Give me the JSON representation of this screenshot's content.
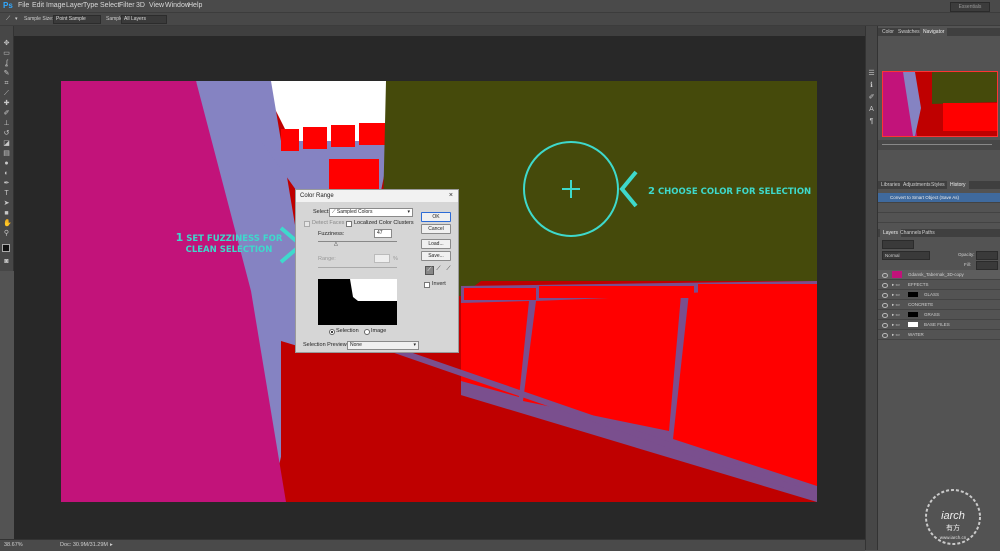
{
  "app": {
    "logo": "Ps"
  },
  "menu": [
    "File",
    "Edit",
    "Image",
    "Layer",
    "Type",
    "Select",
    "Filter",
    "3D",
    "View",
    "Window",
    "Help"
  ],
  "workspace_label": "Essentials",
  "options": {
    "sample_size_label": "Sample Size:",
    "sample_size_value": "Point Sample",
    "sample_label": "Sample:",
    "sample_value": "All Layers"
  },
  "status": {
    "zoom": "38.67%",
    "doc": "Doc: 30.9M/31.29M"
  },
  "dialog": {
    "title": "Color Range",
    "select_label": "Select:",
    "select_value": "Sampled Colors",
    "detect_faces": "Detect Faces",
    "localized": "Localized Color Clusters",
    "fuzziness_label": "Fuzziness:",
    "fuzziness_value": "47",
    "range_label": "Range:",
    "range_unit": "%",
    "selection": "Selection",
    "image": "Image",
    "preview_label": "Selection Preview:",
    "preview_value": "None",
    "ok": "OK",
    "cancel": "Cancel",
    "load": "Load...",
    "save": "Save...",
    "invert": "Invert"
  },
  "panels": {
    "top_tabs": [
      "Color",
      "Swatches",
      "Navigator"
    ],
    "mid_tabs": [
      "Libraries",
      "Adjustments",
      "Styles",
      "History"
    ],
    "history_items": [
      "Convert to Smart Object (Save As)"
    ],
    "layer_tabs": [
      "Layers",
      "Channels",
      "Paths"
    ],
    "blend_mode": "Normal",
    "opacity_label": "Opacity:",
    "fill_label": "Fill:",
    "layers": [
      {
        "name": "Gdansk_Tabernak_3D-copy"
      },
      {
        "name": "EFFECTS"
      },
      {
        "name": "GLASS"
      },
      {
        "name": "CONCRETE"
      },
      {
        "name": "GRASS"
      },
      {
        "name": "BASE FILES"
      },
      {
        "name": "WATER"
      }
    ]
  },
  "annotations": {
    "step1_num": "1",
    "step1_line1": "SET FUZZINESS FOR",
    "step1_line2": "CLEAN SELECTION",
    "step2_num": "2",
    "step2_text": "CHOOSE COLOR FOR SELECTION"
  },
  "watermark": {
    "brand": "iarch",
    "cjk": "有方",
    "url": "www.iarch.cn"
  },
  "colors": {
    "magenta": "#c2137a",
    "lavender": "#8583c2",
    "olive": "#454a0b",
    "red": "#ff0000",
    "dark_red": "#bf0000",
    "purple_frame": "#7a4f8e",
    "annotation": "#3ed9cc"
  }
}
